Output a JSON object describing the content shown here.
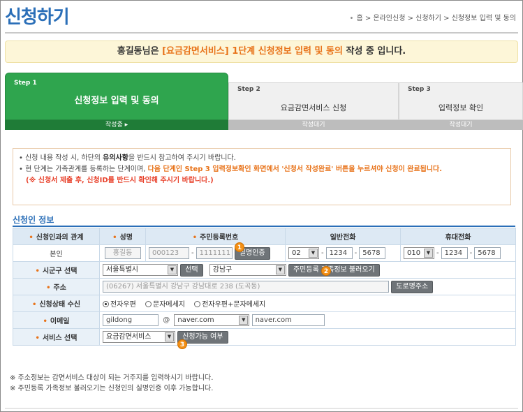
{
  "header": {
    "title": "신청하기",
    "breadcrumb": "홈 > 온라인신청 > 신청하기 > 신청정보 입력 및 동의"
  },
  "notice": {
    "prefix": "홍길동님은 ",
    "highlight": "[요금감면서비스] 1단계 신청정보 입력 및 동의",
    "suffix": " 작성 중 입니다."
  },
  "steps": [
    {
      "num": "Step 1",
      "title": "신청정보 입력 및 동의",
      "state": "작성중 ▸"
    },
    {
      "num": "Step 2",
      "title": "요금감면서비스 신청",
      "state": "작성대기"
    },
    {
      "num": "Step 3",
      "title": "입력정보 확인",
      "state": "작성대기"
    }
  ],
  "info": {
    "line1_a": "• 신청 내용 작성 시, 하단의 ",
    "line1_b": "유의사항",
    "line1_c": "을 반드시 참고하여 주시기 바랍니다.",
    "line2_a": "• 현 단계는 가족관계를 등록하는 단계이며, ",
    "line2_b": "다음 단계인 Step 3 입력정보확인 화면에서 '신청서 작성완료' 버튼을 누르셔야 신청이 완료됩니다.",
    "line3": "(※ 신청서 제출 후, 신청ID를 반드시 확인해 주시기 바랍니다.)"
  },
  "section_title": "신청인 정보",
  "table": {
    "headers": [
      "신청인과의 관계",
      "성명",
      "주민등록번호",
      "일반전화",
      "휴대전화"
    ],
    "row": {
      "relation": "본인",
      "name": "홍길동",
      "rrn1": "000123",
      "rrn2": "1111111",
      "verify_btn": "실명인증",
      "phone": [
        "02",
        "1234",
        "5678"
      ],
      "mobile": [
        "010",
        "1234",
        "5678"
      ]
    },
    "region": {
      "label": "시군구 선택",
      "city": "서울특별시",
      "select_btn": "선택",
      "district": "강남구",
      "family_btn": "주민등록 가족정보 불러오기"
    },
    "address": {
      "label": "주소",
      "value": "(06267) 서울특별시 강남구 강남대로 238 (도곡동)",
      "road_btn": "도로명주소"
    },
    "status": {
      "label": "신청상태 수신",
      "options": [
        "전자우편",
        "문자메세지",
        "전자우편+문자메세지"
      ],
      "selected": 0
    },
    "email": {
      "label": "이메일",
      "id": "gildong",
      "at": "@",
      "domain_select": "naver.com",
      "domain": "naver.com"
    },
    "service": {
      "label": "서비스 선택",
      "value": "요금감면서비스",
      "check_btn": "신청가능 여부"
    }
  },
  "badges": [
    "1",
    "2",
    "3"
  ],
  "footnotes": [
    "※ 주소정보는 감면서비스 대상이 되는 거주지를 입력하시기 바랍니다.",
    "※ 주민등록 가족정보 불러오기는 신청인의 실명인증 이후 가능합니다."
  ],
  "colors": {
    "title_blue": "#2b6fb8",
    "step_green": "#2fa54e",
    "highlight_orange": "#e8731a",
    "badge_orange": "#f39016"
  }
}
